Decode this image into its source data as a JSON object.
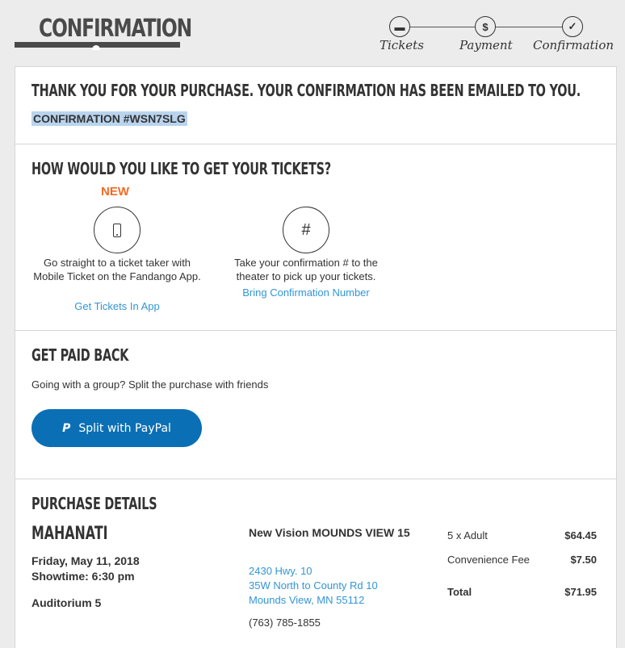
{
  "header": {
    "title": "CONFIRMATION",
    "steps": [
      {
        "label": "Tickets",
        "icon": "ticket-icon",
        "glyph": "▬"
      },
      {
        "label": "Payment",
        "icon": "dollar-icon",
        "glyph": "$"
      },
      {
        "label": "Confirmation",
        "icon": "check-icon",
        "glyph": "✓"
      }
    ]
  },
  "thanks": {
    "heading": "THANK YOU FOR YOUR PURCHASE. YOUR CONFIRMATION HAS BEEN EMAILED TO YOU.",
    "confirmation": "CONFIRMATION #WSN7SLG",
    "highlight_color": "#b9d4ee"
  },
  "delivery": {
    "heading": "HOW WOULD YOU LIKE TO GET YOUR TICKETS?",
    "new_badge": "NEW",
    "mobile": {
      "icon": "mobile-phone-icon",
      "description": "Go straight to a ticket taker with Mobile Ticket on the Fandango App.",
      "link": "Get Tickets In App"
    },
    "pickup": {
      "icon": "hash-icon",
      "glyph": "#",
      "description": "Take your confirmation # to the theater to pick up your tickets.",
      "link": "Bring Confirmation Number"
    }
  },
  "paid_back": {
    "heading": "GET PAID BACK",
    "text": "Going with a group? Split the purchase with friends",
    "button": "Split with PayPal",
    "paypal_glyph": "P",
    "button_color": "#0a6fb5"
  },
  "purchase": {
    "heading": "PURCHASE DETAILS",
    "movie": "MAHANATI",
    "date": "Friday, May 11, 2018",
    "showtime": "Showtime: 6:30 pm",
    "auditorium": "Auditorium 5",
    "theater": "New Vision MOUNDS VIEW 15",
    "address1": "2430 Hwy. 10",
    "address2": "35W North to County Rd 10",
    "address3": "Mounds View, MN 55112",
    "phone": "(763) 785-1855",
    "lines": [
      {
        "label": "5 x Adult",
        "value": "$64.45"
      },
      {
        "label": "Convenience Fee",
        "value": "$7.50"
      },
      {
        "label": "Total",
        "value": "$71.95"
      }
    ]
  },
  "colors": {
    "accent": "#3296d6",
    "new": "#f36b24",
    "text": "#333333"
  }
}
